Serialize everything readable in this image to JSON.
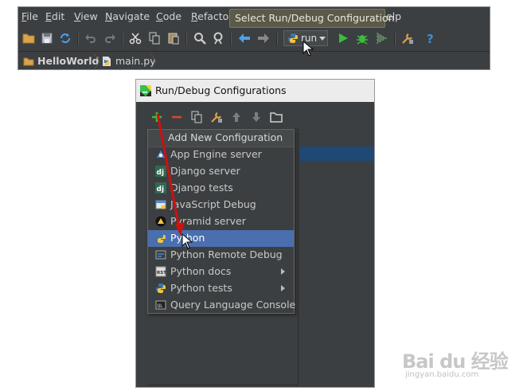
{
  "ide": {
    "menu": [
      {
        "label": "File",
        "mn": "F",
        "rest": "ile"
      },
      {
        "label": "Edit",
        "mn": "E",
        "rest": "dit"
      },
      {
        "label": "View",
        "mn": "V",
        "rest": "iew"
      },
      {
        "label": "Navigate",
        "mn": "N",
        "rest": "avigate"
      },
      {
        "label": "Code",
        "mn": "C",
        "rest": "ode"
      },
      {
        "label": "Refactor",
        "mn": "R",
        "rest": "efactor"
      },
      {
        "label": "Help (partially hidden)",
        "mn": "",
        "rest": "elp"
      }
    ],
    "tooltip": "Select Run/Debug Configuration",
    "run_config_label": "run",
    "breadcrumbs": [
      "HelloWorld",
      "main.py"
    ]
  },
  "dialog": {
    "title": "Run/Debug Configurations",
    "popup": {
      "header": "Add New Configuration",
      "items": [
        {
          "label": "App Engine server",
          "icon": "app-engine-icon",
          "submenu": false,
          "selected": false
        },
        {
          "label": "Django server",
          "icon": "django-icon",
          "submenu": false,
          "selected": false
        },
        {
          "label": "Django tests",
          "icon": "django-icon",
          "submenu": false,
          "selected": false
        },
        {
          "label": "JavaScript Debug",
          "icon": "javascript-debug-icon",
          "submenu": false,
          "selected": false
        },
        {
          "label": "Pyramid server",
          "icon": "pyramid-icon",
          "submenu": false,
          "selected": false
        },
        {
          "label": "Python",
          "icon": "python-icon",
          "submenu": false,
          "selected": true
        },
        {
          "label": "Python Remote Debug",
          "icon": "python-remote-debug-icon",
          "submenu": false,
          "selected": false
        },
        {
          "label": "Python docs",
          "icon": "python-docs-icon",
          "submenu": true,
          "selected": false
        },
        {
          "label": "Python tests",
          "icon": "python-tests-icon",
          "submenu": true,
          "selected": false
        },
        {
          "label": "Query Language Console",
          "icon": "query-console-icon",
          "submenu": false,
          "selected": false
        }
      ]
    }
  },
  "watermark": {
    "logo": "Bai du 经验",
    "url": "jingyan.baidu.com"
  },
  "colors": {
    "ide_bg": "#3c3f41",
    "selection": "#4b6eaf",
    "tooltip_bg": "#5b5a4a",
    "annotation_arrow": "#cc1111",
    "run_green": "#3dbb3d",
    "help_blue": "#3d8fd9"
  }
}
